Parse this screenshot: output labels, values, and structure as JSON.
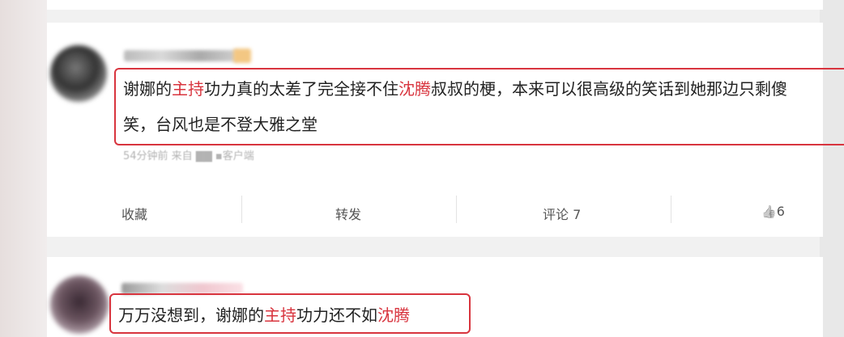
{
  "comments": [
    {
      "text_line1_pre": "谢娜的",
      "text_line1_hl1": "主持",
      "text_line1_mid": "功力真的太差了完全接不住",
      "text_line1_hl2": "沈腾",
      "text_line1_post": "叔叔的梗，本来可以很高级的笑话到她那边只剩傻",
      "text_line2": "笑，台风也是不登大雅之堂",
      "meta": "54分钟前  来自 ▇▇ ▪客户端"
    },
    {
      "text_pre": "万万没想到，谢娜的",
      "text_hl1": "主持",
      "text_mid": "功力还不如",
      "text_hl2": "沈腾"
    }
  ],
  "actions": {
    "collect": "收藏",
    "repost": "转发",
    "comment": "评论 7",
    "like_icon": "👍",
    "like_count": "6"
  },
  "colors": {
    "highlight": "#d8343e",
    "text": "#222222",
    "muted": "#b3b3b3"
  }
}
